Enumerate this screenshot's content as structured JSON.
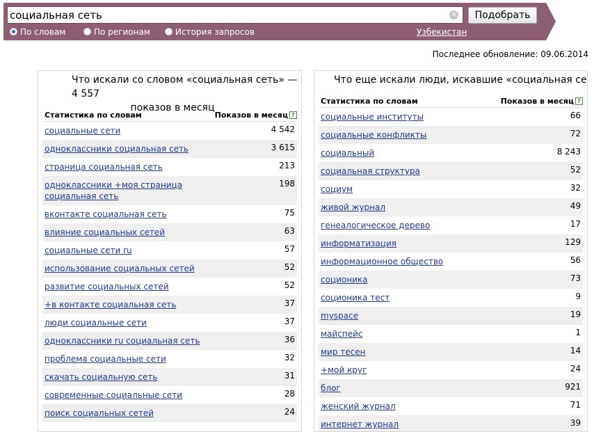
{
  "search": {
    "query": "социальная сеть",
    "submit_label": "Подобрать",
    "options": [
      "По словам",
      "По регионам",
      "История запросов"
    ],
    "selected_option": "По словам",
    "region": "Узбекистан"
  },
  "last_update": "Последнее обновление: 09.06.2014",
  "left_panel": {
    "title_line1": "Что искали со словом «социальная сеть» — 4 557",
    "title_line2": "показов в месяц",
    "col_keyword": "Статистика по словам",
    "col_count": "Показов в месяц",
    "rows": [
      {
        "keyword": "социальные сети",
        "count": "4 542"
      },
      {
        "keyword": "одноклассники социальная сеть",
        "count": "3 615"
      },
      {
        "keyword": "страница социальная сеть",
        "count": "213"
      },
      {
        "keyword": "одноклассники +моя страница социальная сеть",
        "count": "198"
      },
      {
        "keyword": "вконтакте социальная сеть",
        "count": "75"
      },
      {
        "keyword": "влияние социальных сетей",
        "count": "63"
      },
      {
        "keyword": "социальные сети ru",
        "count": "57"
      },
      {
        "keyword": "использование социальных сетей",
        "count": "52"
      },
      {
        "keyword": "развитие социальных сетей",
        "count": "52"
      },
      {
        "keyword": "+в контакте социальная сеть",
        "count": "37"
      },
      {
        "keyword": "люди социальные сети",
        "count": "37"
      },
      {
        "keyword": "одноклассники ru социальная сеть",
        "count": "36"
      },
      {
        "keyword": "проблема социальные сети",
        "count": "32"
      },
      {
        "keyword": "скачать социальную сеть",
        "count": "31"
      },
      {
        "keyword": "современные социальные сети",
        "count": "28"
      },
      {
        "keyword": "поиск социальных сетей",
        "count": "24"
      }
    ]
  },
  "right_panel": {
    "title": "Что еще искали люди, искавшие «социальная сеть»:",
    "col_keyword": "Статистика по словам",
    "col_count": "Показов в месяц",
    "rows": [
      {
        "keyword": "социальные институты",
        "count": "66"
      },
      {
        "keyword": "социальные конфликты",
        "count": "72"
      },
      {
        "keyword": "социальный",
        "count": "8 243"
      },
      {
        "keyword": "социальная структура",
        "count": "52"
      },
      {
        "keyword": "социум",
        "count": "32"
      },
      {
        "keyword": "живой журнал",
        "count": "49"
      },
      {
        "keyword": "генеалогическое дерево",
        "count": "17"
      },
      {
        "keyword": "информатизация",
        "count": "129"
      },
      {
        "keyword": "информационное общество",
        "count": "56"
      },
      {
        "keyword": "соционика",
        "count": "73"
      },
      {
        "keyword": "соционика тест",
        "count": "9"
      },
      {
        "keyword": "myspace",
        "count": "19"
      },
      {
        "keyword": "майспейс",
        "count": "1"
      },
      {
        "keyword": "мир тесен",
        "count": "14"
      },
      {
        "keyword": "+мой круг",
        "count": "24"
      },
      {
        "keyword": "блог",
        "count": "921"
      },
      {
        "keyword": "женский журнал",
        "count": "71"
      },
      {
        "keyword": "интернет журнал",
        "count": "39"
      }
    ]
  }
}
